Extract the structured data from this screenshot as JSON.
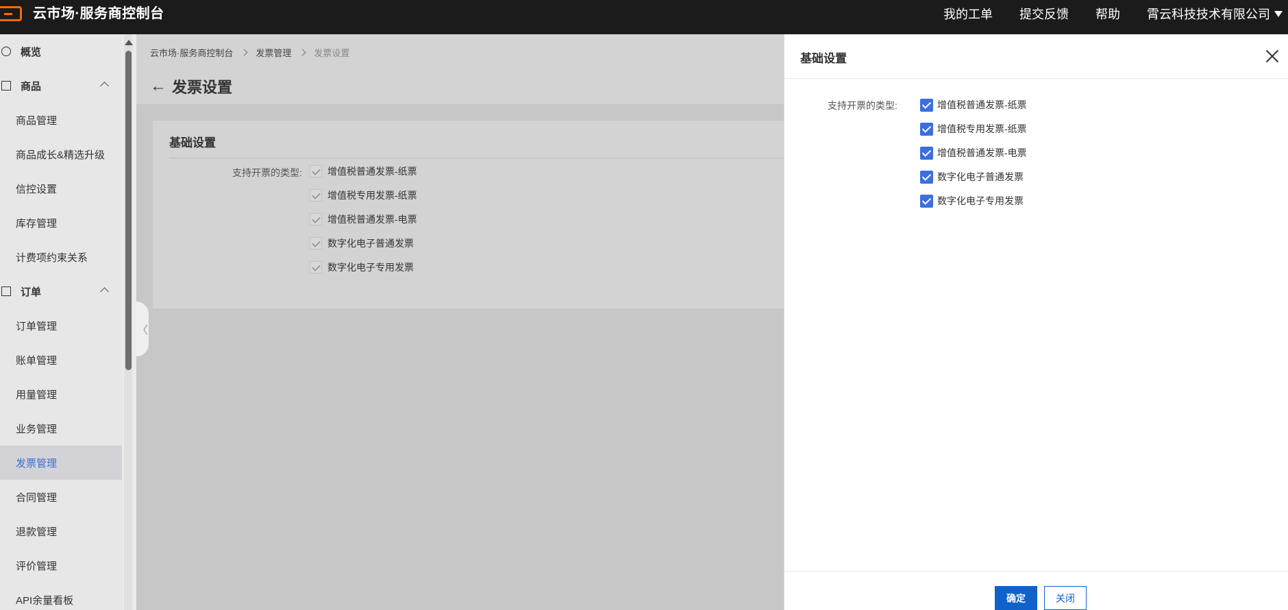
{
  "header": {
    "title": "云市场·服务商控制台",
    "nav": [
      "我的工单",
      "提交反馈",
      "帮助"
    ],
    "company": "霄云科技技术有限公司"
  },
  "sidebar": {
    "items": [
      {
        "label": "概览",
        "type": "group",
        "icon": "pie-chart-icon"
      },
      {
        "label": "商品",
        "type": "group",
        "icon": "shopping-bag-icon"
      },
      {
        "label": "商品管理",
        "type": "sub"
      },
      {
        "label": "商品成长&精选升级",
        "type": "sub"
      },
      {
        "label": "信控设置",
        "type": "sub"
      },
      {
        "label": "库存管理",
        "type": "sub"
      },
      {
        "label": "计费项约束关系",
        "type": "sub"
      },
      {
        "label": "订单",
        "type": "group",
        "icon": "order-icon"
      },
      {
        "label": "订单管理",
        "type": "sub"
      },
      {
        "label": "账单管理",
        "type": "sub"
      },
      {
        "label": "用量管理",
        "type": "sub"
      },
      {
        "label": "业务管理",
        "type": "sub"
      },
      {
        "label": "发票管理",
        "type": "sub",
        "active": true
      },
      {
        "label": "合同管理",
        "type": "sub"
      },
      {
        "label": "退款管理",
        "type": "sub"
      },
      {
        "label": "评价管理",
        "type": "sub"
      },
      {
        "label": "API余量看板",
        "type": "sub"
      }
    ],
    "collapse_glyph": "〈"
  },
  "breadcrumb": [
    "云市场·服务商控制台",
    "发票管理",
    "发票设置"
  ],
  "page": {
    "title": "发票设置",
    "back_glyph": "←",
    "card": {
      "title": "基础设置",
      "label": "支持开票的类型:",
      "options": [
        "增值税普通发票-纸票",
        "增值税专用发票-纸票",
        "增值税普通发票-电票",
        "数字化电子普通发票",
        "数字化电子专用发票"
      ]
    }
  },
  "drawer": {
    "title": "基础设置",
    "label": "支持开票的类型:",
    "options": [
      {
        "label": "增值税普通发票-纸票",
        "checked": true
      },
      {
        "label": "增值税专用发票-纸票",
        "checked": true
      },
      {
        "label": "增值税普通发票-电票",
        "checked": true
      },
      {
        "label": "数字化电子普通发票",
        "checked": true
      },
      {
        "label": "数字化电子专用发票",
        "checked": true
      }
    ],
    "confirm_label": "确定",
    "close_label": "关闭"
  },
  "colors": {
    "accent": "#0f62c9",
    "checkbox": "#3b6fe0",
    "brand_orange": "#ff6a00",
    "active_menu_text": "#3d6fd6"
  }
}
